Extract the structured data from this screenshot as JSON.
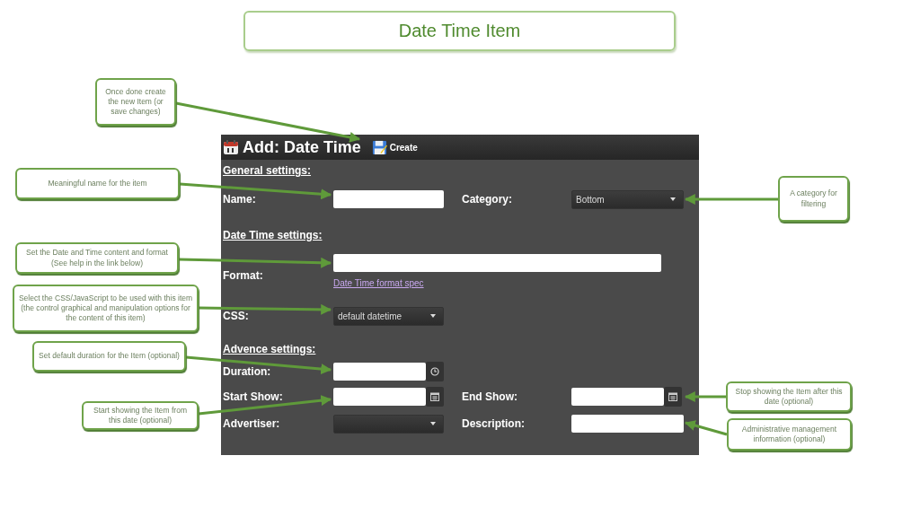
{
  "title": "Date Time Item",
  "panel": {
    "heading": "Add: Date Time",
    "create_button": "Create",
    "general_heading": "General settings:",
    "name_label": "Name:",
    "category_label": "Category:",
    "category_value": "Bottom",
    "datetime_heading": "Date Time settings:",
    "format_label": "Format:",
    "format_link": "Date Time format spec",
    "css_label": "CSS:",
    "css_value": "default datetime",
    "advanced_heading": "Advence settings:",
    "duration_label": "Duration:",
    "start_label": "Start Show:",
    "end_label": "End Show:",
    "advertiser_label": "Advertiser:",
    "description_label": "Description:"
  },
  "callouts": [
    {
      "text": "Once done create the new Item (or save changes)"
    },
    {
      "text": "Meaningful name for the item"
    },
    {
      "text": "Set the Date and Time content and format (See help in the link below)"
    },
    {
      "text": "Select the CSS/JavaScript to be used with this item (the control graphical and manipulation options for the content of this item)"
    },
    {
      "text": "Set default duration for the Item (optional)"
    },
    {
      "text": "Start showing the Item from this date (optional)"
    },
    {
      "text": "A category for filtering"
    },
    {
      "text": "Stop showing the Item after this date (optional)"
    },
    {
      "text": "Administrative management information (optional)"
    }
  ]
}
